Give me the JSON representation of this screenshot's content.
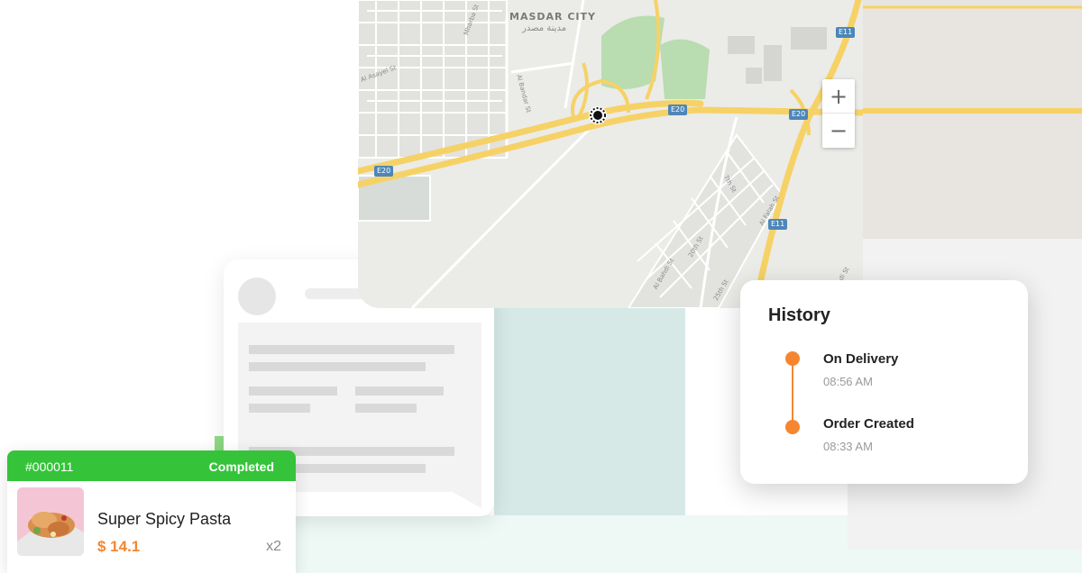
{
  "map": {
    "area_label": "MASDAR CITY",
    "area_label_arabic": "مدينة مصدر",
    "zoom_in_label": "+",
    "zoom_out_label": "−",
    "road_shields": [
      "E11",
      "E20",
      "E20",
      "E20",
      "E11"
    ],
    "streets": [
      "Mharba St",
      "Al Asayel St",
      "Al Bandar St",
      "7th St",
      "Al Falah St",
      "Al Bahdi St",
      "20th St",
      "25th St",
      "Ahmed Mahdi St"
    ]
  },
  "history": {
    "title": "History",
    "events": [
      {
        "title": "On Delivery",
        "time": "08:56 AM"
      },
      {
        "title": "Order Created",
        "time": "08:33 AM"
      }
    ]
  },
  "order": {
    "id": "#000011",
    "status": "Completed",
    "item_name": "Super Spicy Pasta",
    "price": "$ 14.1",
    "quantity": "x2"
  },
  "colors": {
    "accent_orange": "#f5862f",
    "status_green": "#35c33a",
    "road_yellow": "#f6d266",
    "park_green": "#b9dcb0"
  },
  "icons": [
    "location-pin-icon",
    "zoom-in-icon",
    "zoom-out-icon",
    "food-image"
  ]
}
